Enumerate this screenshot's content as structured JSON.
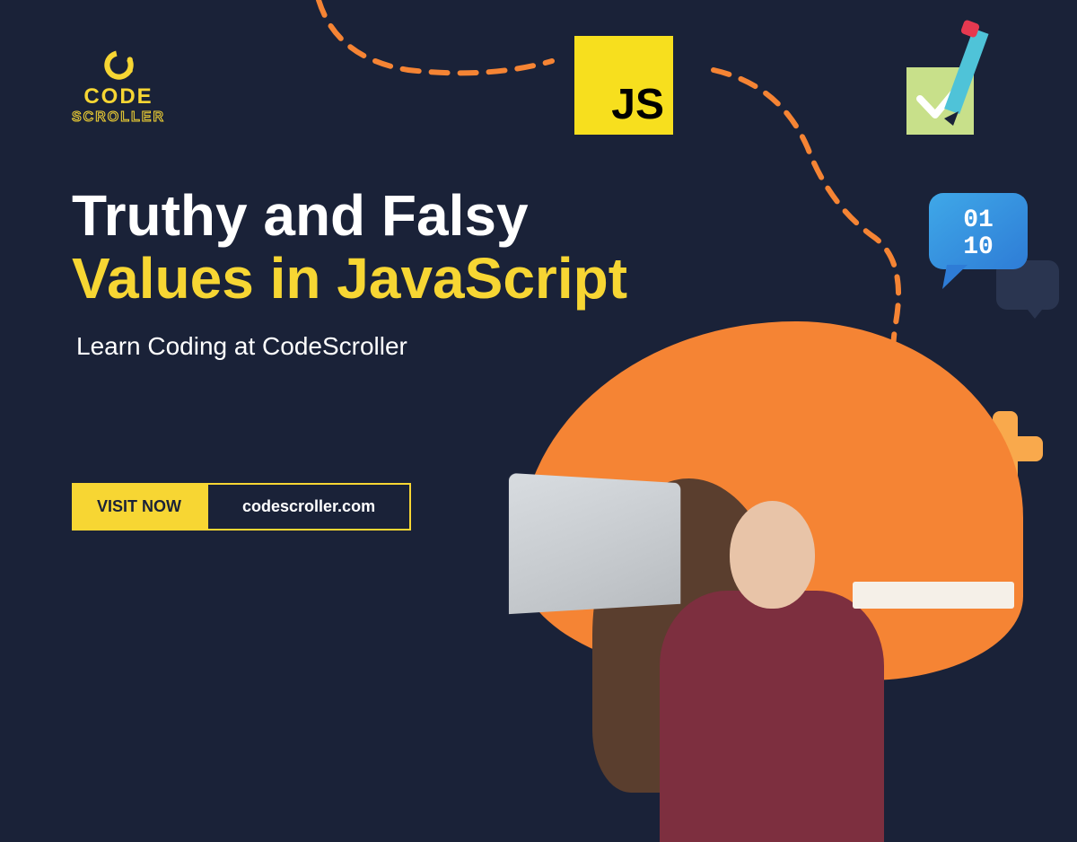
{
  "logo": {
    "code": "CODE",
    "scroller": "SCROLLER"
  },
  "headline": {
    "line1": "Truthy and Falsy",
    "line2": "Values in JavaScript"
  },
  "subtitle": "Learn Coding at CodeScroller",
  "cta": {
    "button": "VISIT NOW",
    "url": "codescroller.com"
  },
  "js_logo": "JS",
  "binary": {
    "line1": "01",
    "line2": "10"
  }
}
